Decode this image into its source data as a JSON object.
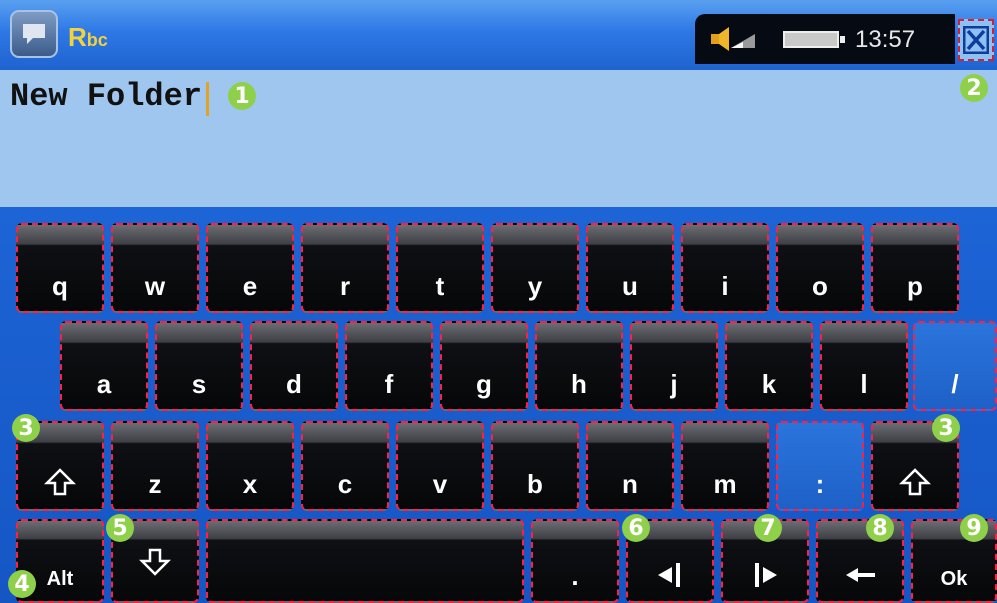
{
  "header": {
    "mode_label": "Rbc",
    "clock": "13:57"
  },
  "text_field": {
    "value": "New Folder"
  },
  "keyboard": {
    "row1": [
      "q",
      "w",
      "e",
      "r",
      "t",
      "y",
      "u",
      "i",
      "o",
      "p"
    ],
    "row2": [
      "a",
      "s",
      "d",
      "f",
      "g",
      "h",
      "j",
      "k",
      "l",
      "/"
    ],
    "row3_letters": [
      "z",
      "x",
      "c",
      "v",
      "b",
      "n",
      "m",
      ":"
    ],
    "alt_label": "Alt",
    "period_label": ".",
    "ok_label": "Ok"
  },
  "callouts": [
    "1",
    "2",
    "3",
    "3",
    "4",
    "5",
    "6",
    "7",
    "8",
    "9"
  ],
  "icons": {
    "app": "chat-bubble-icon",
    "speaker": "speaker-icon",
    "battery": "battery-icon",
    "close": "close-icon",
    "shift": "shift-up-arrow-icon",
    "shift_down": "shift-down-arrow-icon",
    "cursor_left": "cursor-left-icon",
    "cursor_right": "cursor-right-icon",
    "backspace": "backspace-arrow-icon"
  },
  "colors": {
    "background": "#1a5fd0",
    "text_area": "#9fc6ef",
    "mode_label": "#f2d23c",
    "callout": "#8ed04a",
    "key_outline": "#ff1f45"
  }
}
